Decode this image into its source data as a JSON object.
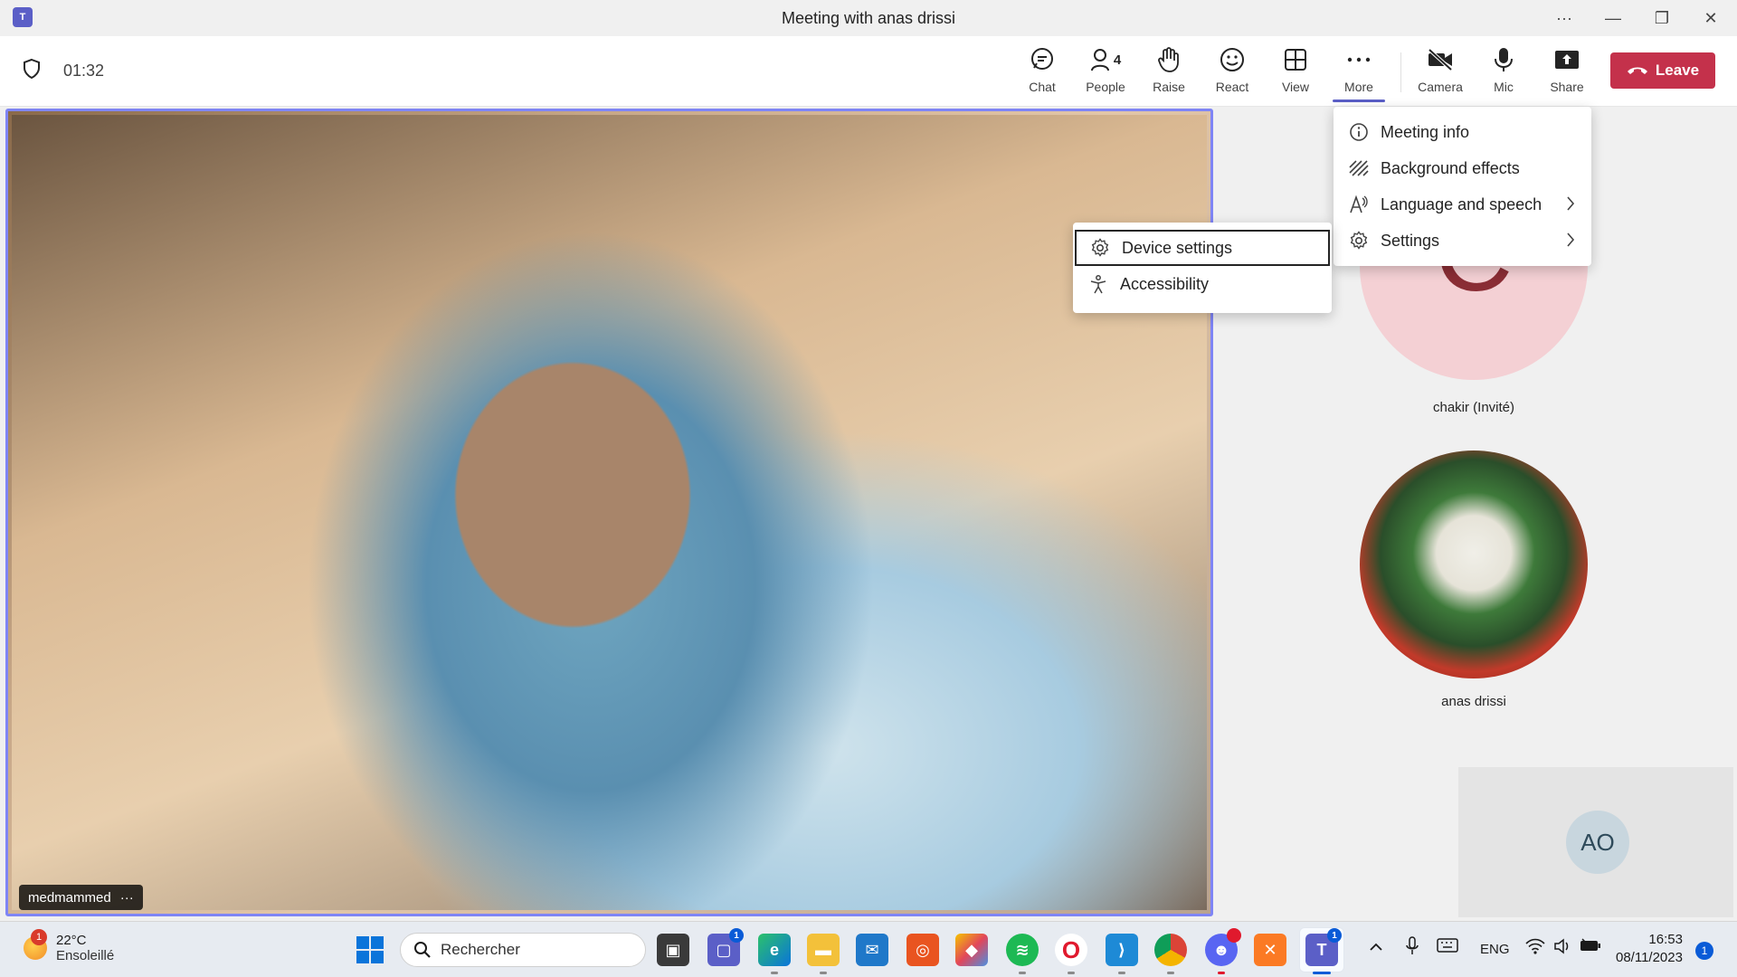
{
  "window": {
    "title": "Meeting with anas drissi",
    "app_icon": "teams-icon"
  },
  "toolbar": {
    "timer": "01:32",
    "buttons": [
      {
        "label": "Chat",
        "icon": "chat-icon"
      },
      {
        "label": "People",
        "icon": "people-icon",
        "count": "4"
      },
      {
        "label": "Raise",
        "icon": "hand-icon"
      },
      {
        "label": "React",
        "icon": "smiley-icon"
      },
      {
        "label": "View",
        "icon": "grid-view-icon"
      },
      {
        "label": "More",
        "icon": "ellipsis-icon"
      },
      {
        "label": "Camera",
        "icon": "camera-off-icon"
      },
      {
        "label": "Mic",
        "icon": "mic-icon"
      },
      {
        "label": "Share",
        "icon": "share-icon"
      }
    ],
    "leave_label": "Leave",
    "accent_color": "#5b5fc7",
    "leave_color": "#c4314b"
  },
  "more_menu": {
    "items": [
      {
        "label": "Meeting info",
        "icon": "info-icon"
      },
      {
        "label": "Background effects",
        "icon": "background-effects-icon"
      },
      {
        "label": "Language and speech",
        "icon": "language-icon",
        "has_submenu": true
      },
      {
        "label": "Settings",
        "icon": "gear-icon",
        "has_submenu": true
      }
    ]
  },
  "settings_submenu": {
    "items": [
      {
        "label": "Device settings",
        "icon": "gear-icon",
        "focused": true
      },
      {
        "label": "Accessibility",
        "icon": "accessibility-icon"
      }
    ]
  },
  "stage": {
    "main_video_name": "medmammed",
    "participants": [
      {
        "name": "chakir (Invité)",
        "initial": "C"
      },
      {
        "name": "anas drissi"
      }
    ],
    "self_initials": "AO"
  },
  "taskbar": {
    "weather_temp": "22°C",
    "weather_desc": "Ensoleillé",
    "weather_badge": "1",
    "search_placeholder": "Rechercher",
    "chat_badge": "1",
    "discord_badge": "",
    "teams_badge": "1",
    "language": "ENG",
    "time": "16:53",
    "date": "08/11/2023",
    "notification_count": "1"
  }
}
